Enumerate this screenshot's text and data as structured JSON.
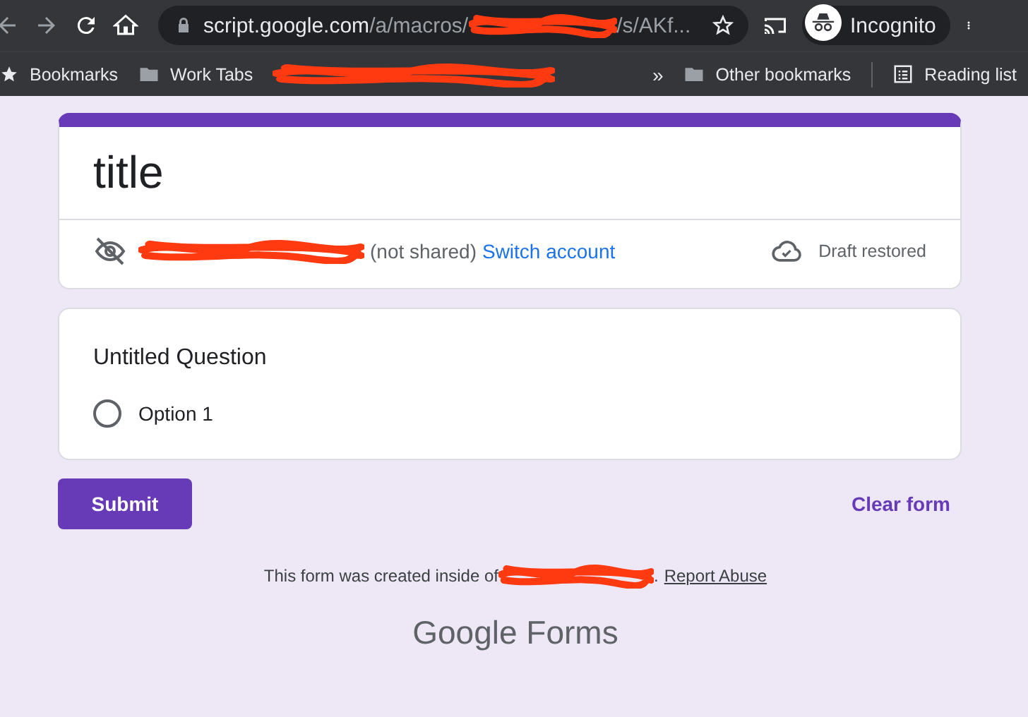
{
  "browser": {
    "url_host": "script.google.com",
    "url_path_start": "/a/macros/",
    "url_path_end": "/s/AKf...",
    "profile": "Incognito",
    "bookmarks": [
      {
        "label": "Bookmarks",
        "kind": "star"
      },
      {
        "label": "Work Tabs",
        "kind": "folder"
      },
      {
        "kind": "redacted"
      }
    ],
    "other_bookmarks": "Other bookmarks",
    "reading_list": "Reading list",
    "overflow": "»"
  },
  "form": {
    "title": "title",
    "account_note": "(not shared)",
    "switch_account": "Switch account",
    "draft_status": "Draft restored",
    "questions": [
      {
        "title": "Untitled Question",
        "options": [
          {
            "label": "Option 1",
            "selected": false
          }
        ]
      }
    ],
    "submit": "Submit",
    "clear": "Clear form",
    "footer_text": "This form was created inside of",
    "footer_end": ".",
    "report_abuse": "Report Abuse",
    "logo_google": "Google",
    "logo_forms": "Forms"
  }
}
